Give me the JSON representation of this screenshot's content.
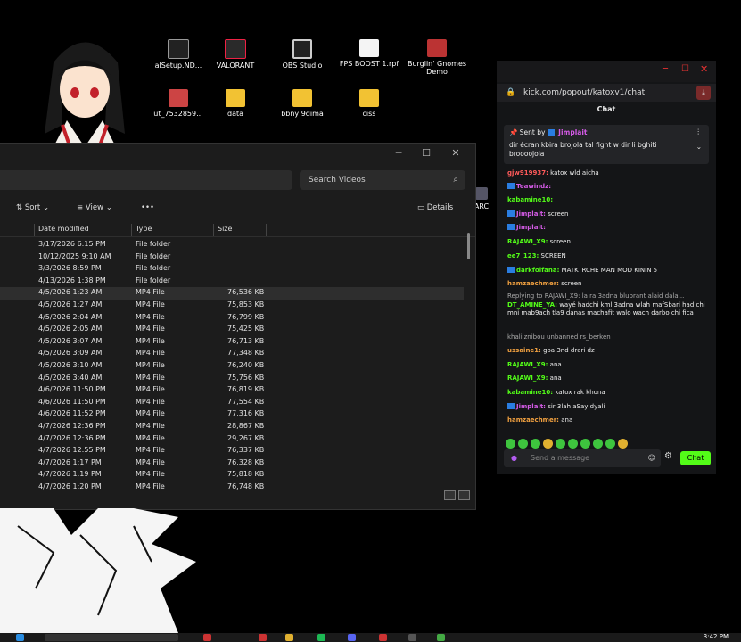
{
  "desktop": {
    "icons": [
      {
        "label": "alSetup.ND...",
        "icon": "app-icon"
      },
      {
        "label": "VALORANT",
        "icon": "valorant-icon"
      },
      {
        "label": "OBS Studio",
        "icon": "obs-icon"
      },
      {
        "label": "FPS BOOST 1.rpf",
        "icon": "file-icon"
      },
      {
        "label": "Burglin' Gnomes Demo",
        "icon": "game-icon"
      },
      {
        "label": "ut_7532859...",
        "icon": "app-icon"
      },
      {
        "label": "data",
        "icon": "folder-icon"
      },
      {
        "label": "bbny 9dima",
        "icon": "folder-icon"
      },
      {
        "label": "ciss",
        "icon": "folder-icon"
      },
      {
        "label": "ARC",
        "icon": "app-icon"
      }
    ]
  },
  "explorer": {
    "search_placeholder": "Search Videos",
    "toolbar": {
      "sort": "Sort",
      "view": "View",
      "more": "•••",
      "details": "Details"
    },
    "columns": {
      "date": "Date modified",
      "type": "Type",
      "size": "Size"
    },
    "rows": [
      {
        "date": "3/17/2026 6:15 PM",
        "type": "File folder",
        "size": ""
      },
      {
        "date": "10/12/2025 9:10 AM",
        "type": "File folder",
        "size": ""
      },
      {
        "date": "3/3/2026 8:59 PM",
        "type": "File folder",
        "size": ""
      },
      {
        "date": "4/13/2026 1:38 PM",
        "type": "File folder",
        "size": ""
      },
      {
        "date": "4/5/2026 1:23 AM",
        "type": "MP4 File",
        "size": "76,536 KB"
      },
      {
        "date": "4/5/2026 1:27 AM",
        "type": "MP4 File",
        "size": "75,853 KB"
      },
      {
        "date": "4/5/2026 2:04 AM",
        "type": "MP4 File",
        "size": "76,799 KB"
      },
      {
        "date": "4/5/2026 2:05 AM",
        "type": "MP4 File",
        "size": "75,425 KB"
      },
      {
        "date": "4/5/2026 3:07 AM",
        "type": "MP4 File",
        "size": "76,713 KB"
      },
      {
        "date": "4/5/2026 3:09 AM",
        "type": "MP4 File",
        "size": "77,348 KB"
      },
      {
        "date": "4/5/2026 3:10 AM",
        "type": "MP4 File",
        "size": "76,240 KB"
      },
      {
        "date": "4/5/2026 3:40 AM",
        "type": "MP4 File",
        "size": "75,756 KB"
      },
      {
        "date": "4/6/2026 11:50 PM",
        "type": "MP4 File",
        "size": "76,819 KB"
      },
      {
        "date": "4/6/2026 11:50 PM",
        "type": "MP4 File",
        "size": "77,554 KB"
      },
      {
        "date": "4/6/2026 11:52 PM",
        "type": "MP4 File",
        "size": "77,316 KB"
      },
      {
        "date": "4/7/2026 12:36 PM",
        "type": "MP4 File",
        "size": "28,867 KB"
      },
      {
        "date": "4/7/2026 12:36 PM",
        "type": "MP4 File",
        "size": "29,267 KB"
      },
      {
        "date": "4/7/2026 12:55 PM",
        "type": "MP4 File",
        "size": "76,337 KB"
      },
      {
        "date": "4/7/2026 1:17 PM",
        "type": "MP4 File",
        "size": "76,328 KB"
      },
      {
        "date": "4/7/2026 1:19 PM",
        "type": "MP4 File",
        "size": "75,818 KB"
      },
      {
        "date": "4/7/2026 1:20 PM",
        "type": "MP4 File",
        "size": "76,748 KB"
      }
    ]
  },
  "chat": {
    "url": "kick.com/popout/katoxv1/chat",
    "header": "Chat",
    "pinned": {
      "label": "Sent by",
      "user": "Jimplait",
      "text": "dir écran kbira brojola tal fight w dir li bghiti broooojola"
    },
    "messages": [
      {
        "user": "gjw919937:",
        "text": "katox wld aicha",
        "cls": "u-r"
      },
      {
        "user": "Teawindz:",
        "text": "",
        "cls": "u-p"
      },
      {
        "user": "kabamine10:",
        "text": "",
        "cls": "u-g"
      },
      {
        "user": "Jimplait:",
        "text": "screen",
        "cls": "u-p"
      },
      {
        "user": "Jimplait:",
        "text": "",
        "cls": "u-p"
      },
      {
        "user": "RAJAWI_X9:",
        "text": "screen",
        "cls": "u-g"
      },
      {
        "user": "ee7_123:",
        "text": "SCREEN",
        "cls": "u-g"
      },
      {
        "user": "darkfolfana:",
        "text": "MATKTRCHE MAN MOD KININ 5",
        "cls": "u-g"
      },
      {
        "user": "hamzaechmer:",
        "text": "screen",
        "cls": "u-o"
      },
      {
        "user": "",
        "text": "Replying to RAJAWI_X9: la ra 3adna bluprant alaid dala...",
        "cls": "sys"
      },
      {
        "user": "DT_AMINE_YA:",
        "text": "wayé hadchi kml 3adna wlah mafSbari had chi mni mab9ach tla9 danas machafit walo wach darbo chi fica",
        "cls": "u-g"
      },
      {
        "user": "",
        "text": "khalilznibou unbanned rs_berken",
        "cls": "sys"
      },
      {
        "user": "ussaine1:",
        "text": "goa 3nd drari dz",
        "cls": "u-o"
      },
      {
        "user": "RAJAWI_X9:",
        "text": "ana",
        "cls": "u-g"
      },
      {
        "user": "RAJAWI_X9:",
        "text": "ana",
        "cls": "u-g"
      },
      {
        "user": "kabamine10:",
        "text": "katox rak khona",
        "cls": "u-g"
      },
      {
        "user": "Jimplait:",
        "text": "sir 3lah aSay dyali",
        "cls": "u-p"
      },
      {
        "user": "hamzaechmer:",
        "text": "ana",
        "cls": "u-o"
      }
    ],
    "input_placeholder": "Send a message",
    "send_label": "Chat"
  },
  "taskbar": {
    "time": "3:42 PM"
  }
}
